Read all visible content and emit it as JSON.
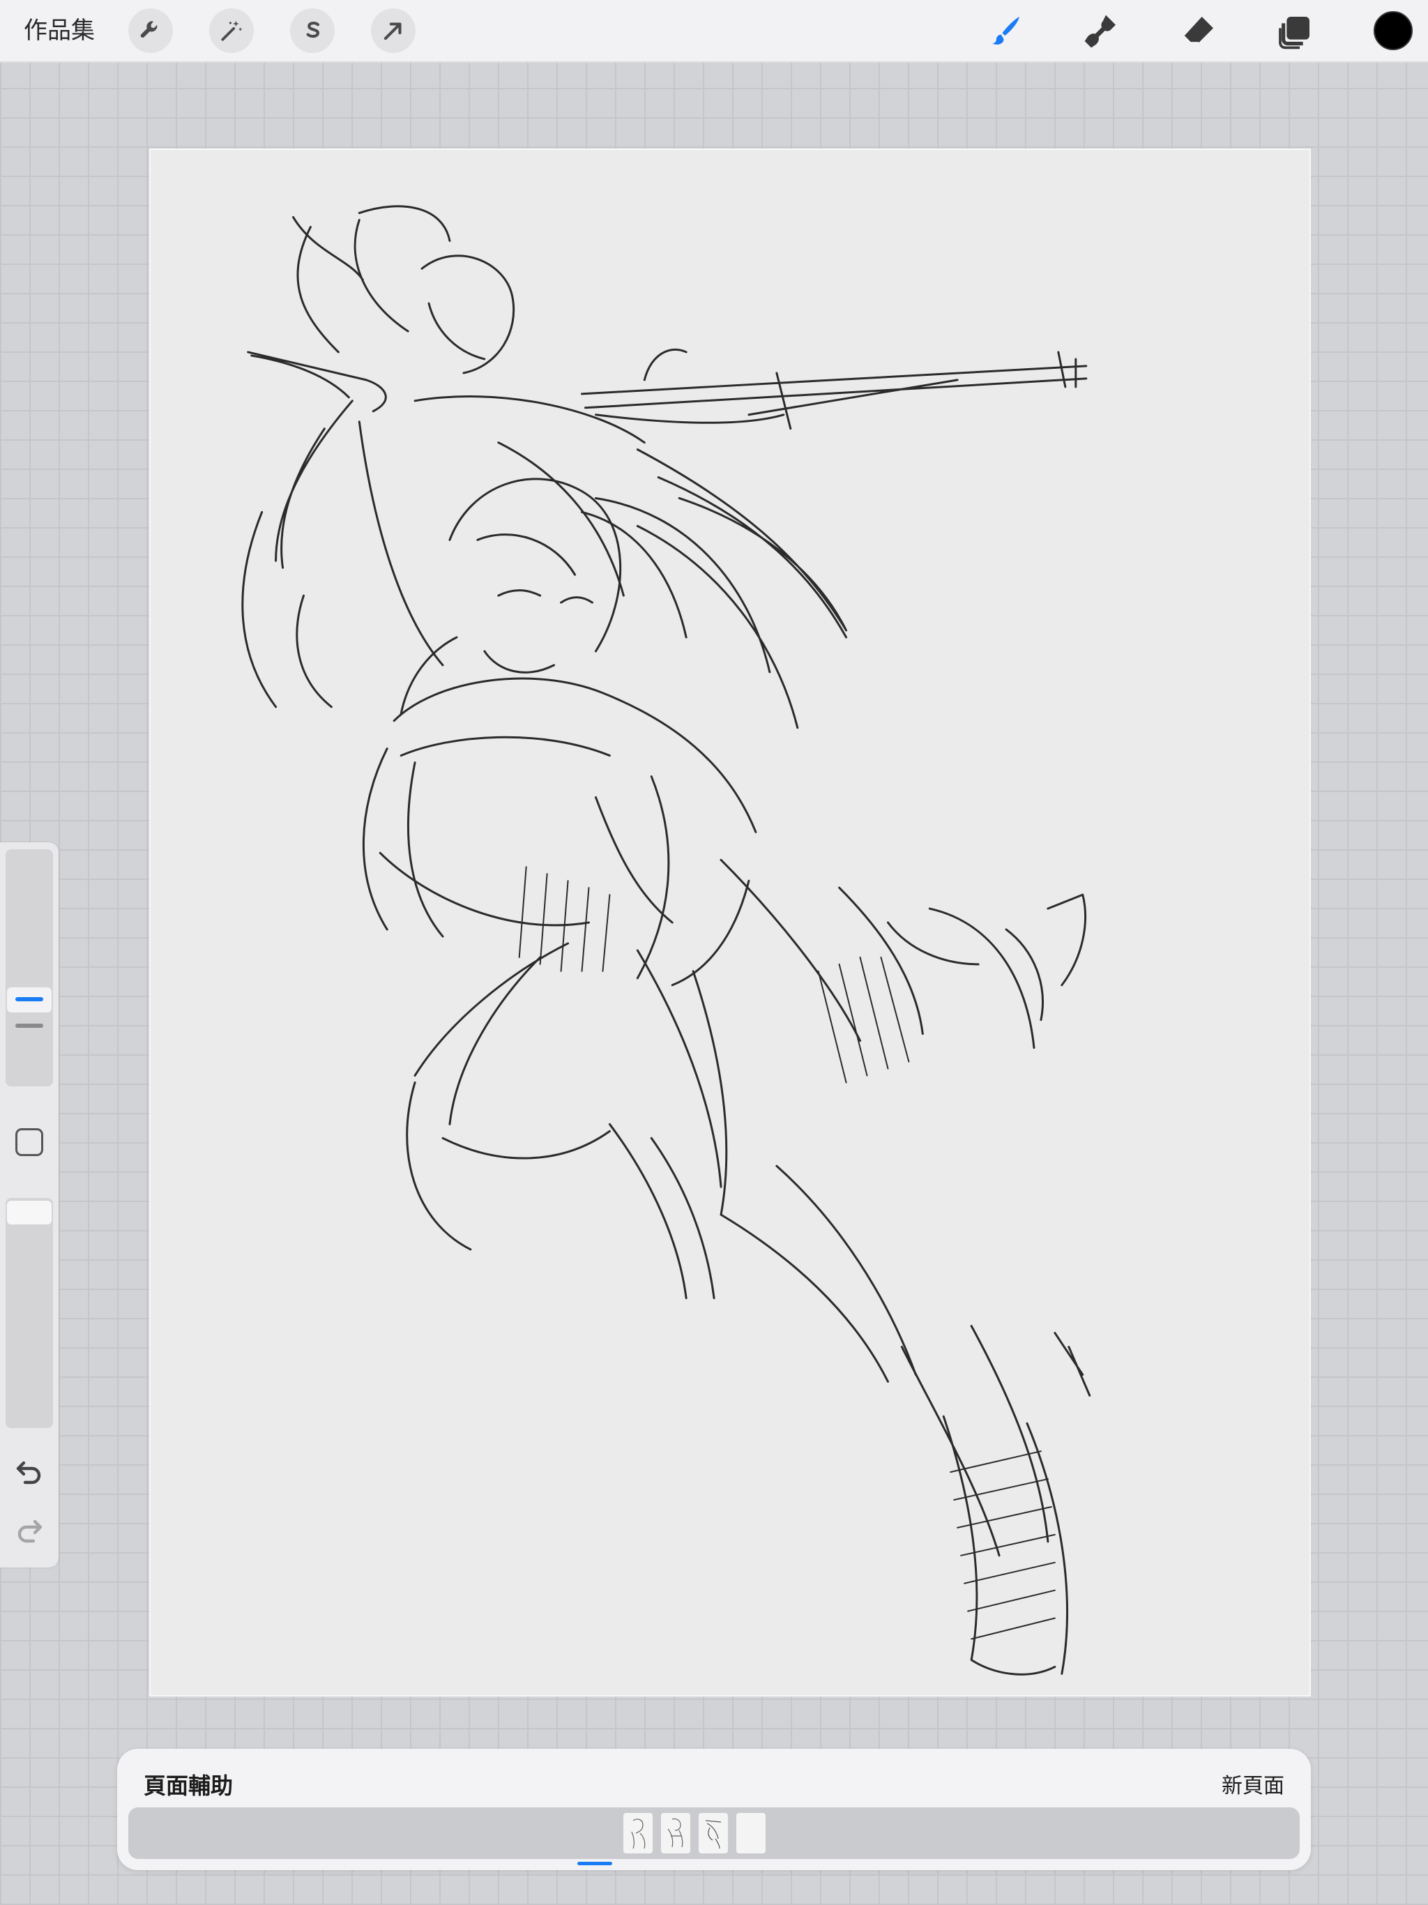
{
  "toolbar": {
    "gallery_label": "作品集",
    "left_tools": [
      {
        "name": "actions",
        "icon": "wrench-icon"
      },
      {
        "name": "adjustments",
        "icon": "magic-wand-icon"
      },
      {
        "name": "selection",
        "icon": "selection-s-icon"
      },
      {
        "name": "transform",
        "icon": "arrow-cursor-icon"
      }
    ],
    "right_tools": [
      {
        "name": "brush",
        "icon": "brush-icon",
        "active": true
      },
      {
        "name": "smudge",
        "icon": "smudge-icon",
        "active": false
      },
      {
        "name": "eraser",
        "icon": "eraser-icon",
        "active": false
      },
      {
        "name": "layers",
        "icon": "layers-icon",
        "active": false
      }
    ],
    "current_color": "#000000",
    "active_color": "#1a7cf5"
  },
  "sidebar": {
    "brush_size_icon": "size-slider",
    "modify_icon": "square-icon",
    "opacity_icon": "opacity-slider",
    "undo_icon": "undo-icon",
    "redo_icon": "redo-icon"
  },
  "page_panel": {
    "title": "頁面輔助",
    "new_page_label": "新頁面",
    "page_count": 4,
    "active_page": 3
  }
}
